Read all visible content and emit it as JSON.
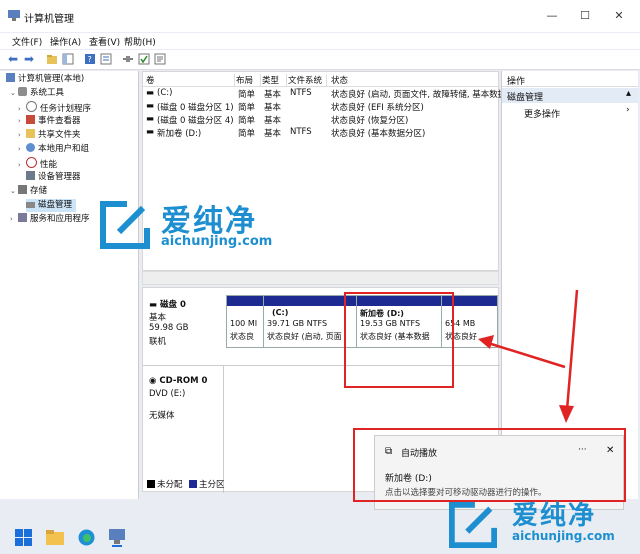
{
  "window": {
    "title": "计算机管理"
  },
  "menu": [
    "文件(F)",
    "操作(A)",
    "查看(V)",
    "帮助(H)"
  ],
  "tree": [
    {
      "label": "计算机管理(本地)",
      "level": 0,
      "expanded": true
    },
    {
      "label": "系统工具",
      "level": 1,
      "expanded": true
    },
    {
      "label": "任务计划程序",
      "level": 2,
      "expanded": false
    },
    {
      "label": "事件查看器",
      "level": 2,
      "expanded": false
    },
    {
      "label": "共享文件夹",
      "level": 2,
      "expanded": false
    },
    {
      "label": "本地用户和组",
      "level": 2,
      "expanded": false
    },
    {
      "label": "性能",
      "level": 2,
      "expanded": false
    },
    {
      "label": "设备管理器",
      "level": 2,
      "expanded": null
    },
    {
      "label": "存储",
      "level": 1,
      "expanded": true
    },
    {
      "label": "磁盘管理",
      "level": 2,
      "expanded": null,
      "selected": true
    },
    {
      "label": "服务和应用程序",
      "level": 1,
      "expanded": false
    }
  ],
  "volume_list": {
    "columns": [
      "卷",
      "布局",
      "类型",
      "文件系统",
      "状态"
    ],
    "rows": [
      [
        "(C:)",
        "简单",
        "基本",
        "NTFS",
        "状态良好 (启动, 页面文件, 故障转储, 基本数据"
      ],
      [
        "(磁盘 0 磁盘分区 1)",
        "简单",
        "基本",
        "",
        "状态良好 (EFI 系统分区)"
      ],
      [
        "(磁盘 0 磁盘分区 4)",
        "简单",
        "基本",
        "",
        "状态良好 (恢复分区)"
      ],
      [
        "新加卷 (D:)",
        "简单",
        "基本",
        "NTFS",
        "状态良好 (基本数据分区)"
      ]
    ]
  },
  "disk0": {
    "name": "磁盘 0",
    "type": "基本",
    "size": "59.98 GB",
    "status": "联机",
    "partitions": [
      {
        "title": "",
        "size": "100 MI",
        "status": "状态良"
      },
      {
        "title": "(C:)",
        "size": "39.71 GB NTFS",
        "status": "状态良好 (启动, 页面"
      },
      {
        "title": "新加卷  (D:)",
        "size": "19.53 GB NTFS",
        "status": "状态良好 (基本数据"
      },
      {
        "title": "",
        "size": "654 MB",
        "status": "状态良好"
      }
    ]
  },
  "cdrom": {
    "name": "CD-ROM 0",
    "type": "DVD (E:)",
    "status": "无媒体"
  },
  "legend": [
    "未分配",
    "主分区"
  ],
  "actions": {
    "header": "操作",
    "section": "磁盘管理",
    "more": "更多操作"
  },
  "toast": {
    "app": "自动播放",
    "more": "···",
    "title": "新加卷 (D:)",
    "body": "点击以选择要对可移动驱动器进行的操作。"
  },
  "watermark": {
    "cn": "爱纯净",
    "url": "aichunjing.com"
  },
  "colors": {
    "primary_partition": "#1c2a91",
    "highlight": "#e02424",
    "watermark": "#1d8fd1"
  }
}
